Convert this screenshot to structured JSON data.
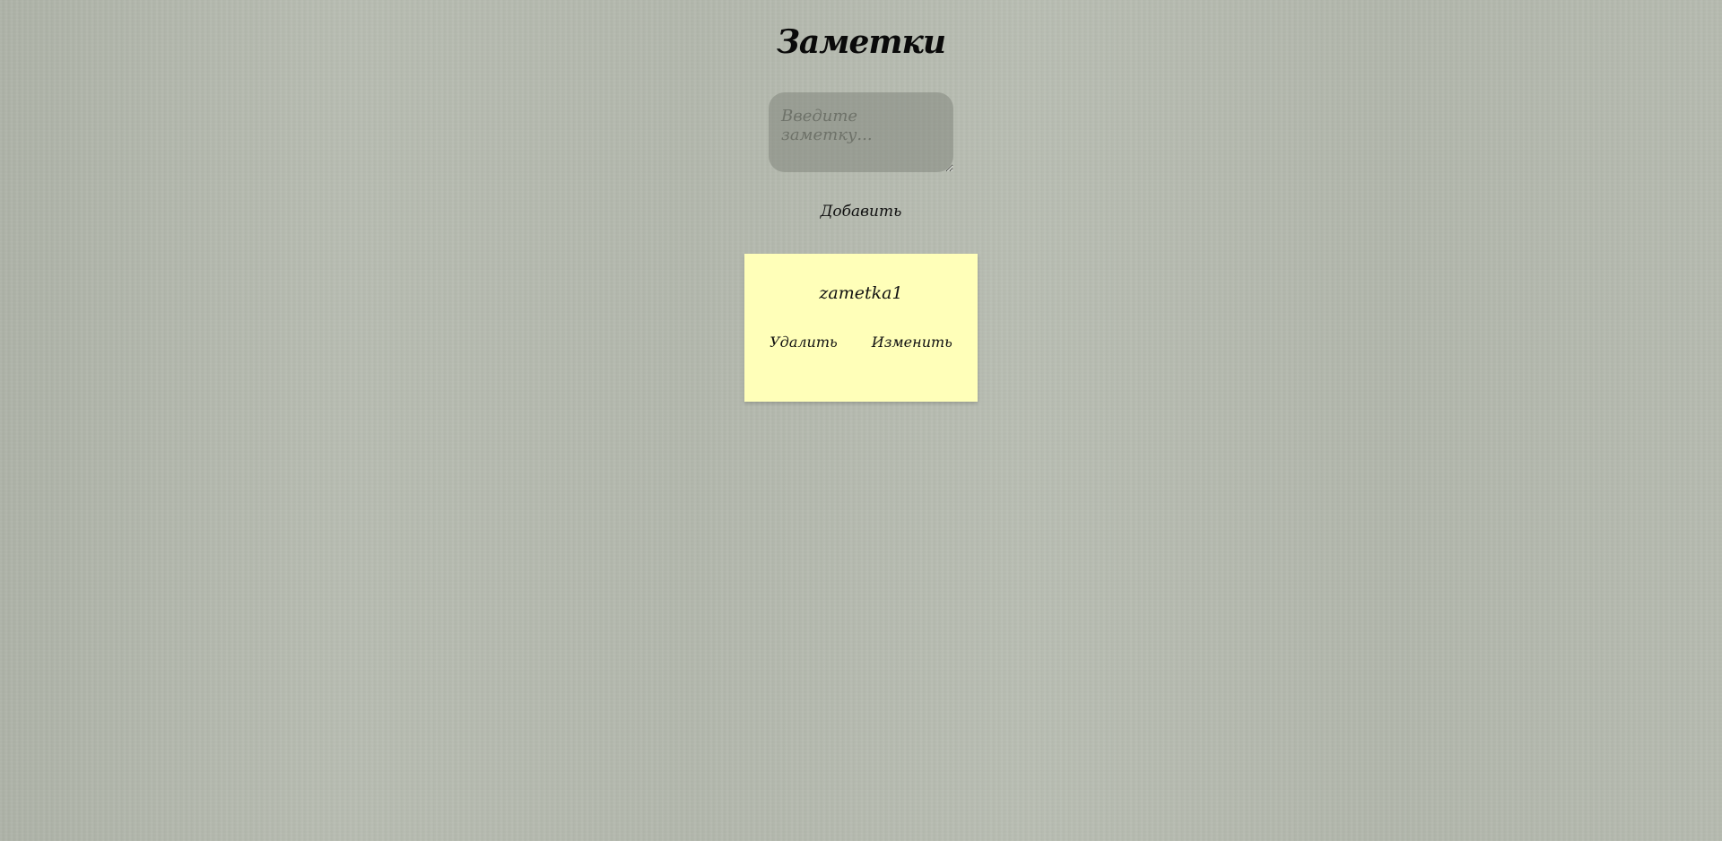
{
  "app": {
    "title": "Заметки"
  },
  "composer": {
    "placeholder": "Введите заметку...",
    "value": "",
    "add_label": "Добавить"
  },
  "notes": [
    {
      "text": "zametka1",
      "delete_label": "Удалить",
      "edit_label": "Изменить"
    }
  ],
  "colors": {
    "background": "#b4b9ae",
    "note_background": "#ffffb9",
    "input_background": "#8f9489"
  }
}
